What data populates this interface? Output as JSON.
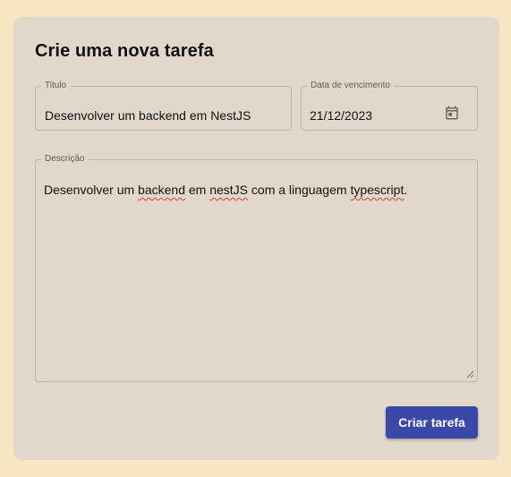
{
  "form": {
    "heading": "Crie uma nova tarefa",
    "title_field": {
      "label": "Titulo",
      "value": "Desenvolver um backend em NestJS"
    },
    "due_date_field": {
      "label": "Data de vencimento",
      "value": "21/12/2023",
      "icon": "calendar-icon"
    },
    "description_field": {
      "label": "Descrição",
      "segments": [
        "Desenvolver um ",
        "backend",
        " em ",
        "nestJS",
        " com a linguagem ",
        "typescript",
        "."
      ]
    },
    "submit_label": "Criar tarefa"
  },
  "colors": {
    "page_background": "#f7e6c1",
    "card_background": "#e1d8cb",
    "button": "#3a48a7",
    "spellcheck_underline": "#d9423a"
  }
}
